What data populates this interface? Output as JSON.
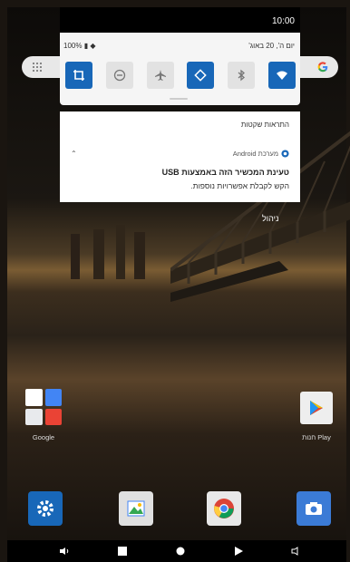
{
  "status_bar": {
    "time": "10:00"
  },
  "quick_settings": {
    "battery": "100%",
    "date": "יום ה', 20 באוג'",
    "tiles": [
      {
        "name": "crop-rotate-icon",
        "state": "on"
      },
      {
        "name": "dnd-icon",
        "state": "off"
      },
      {
        "name": "airplane-icon",
        "state": "off"
      },
      {
        "name": "autorotate-icon",
        "state": "on"
      },
      {
        "name": "bluetooth-icon",
        "state": "off"
      },
      {
        "name": "wifi-icon",
        "state": "on"
      }
    ]
  },
  "notifications": {
    "header": "התראות שקטות",
    "item": {
      "app": "מערכת Android",
      "title": "טעינת המכשיר הזה באמצעות USB",
      "body": "הקש לקבלת אפשרויות נוספות."
    }
  },
  "manage_label": "ניהול",
  "home": {
    "folder_label": "Google",
    "play_label": "חנות Play"
  },
  "colors": {
    "accent": "#1867b8",
    "panel": "#f5f5f5"
  }
}
